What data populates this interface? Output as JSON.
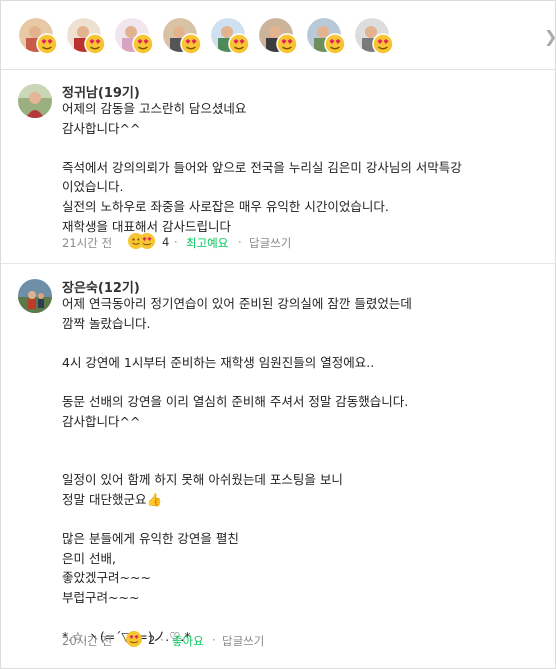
{
  "reactors": {
    "count": 9,
    "next_icon": "chevron-right-icon",
    "reaction_icon": "heart-eyes-emoji-icon"
  },
  "comments": [
    {
      "author": "정귀남(19기)",
      "lines": [
        "어제의 감동을 고스란히 담으셨네요",
        "감사합니다^^",
        "",
        "즉석에서 강의의뢰가 들어와 앞으로 전국을 누리실 김은미 강사님의 서막특강",
        "이었습니다.",
        "실전의 노하우로 좌중을 사로잡은 매우 유익한 시간이었습니다.",
        "재학생을 대표해서 감사드립니다"
      ],
      "time": "21시간 전",
      "reaction_count": "4",
      "reaction_label": "최고예요",
      "reply_label": "답글쓰기"
    },
    {
      "author": "장은숙(12기)",
      "lines": [
        "어제 연극동아리 정기연습이 있어 준비된 강의실에 잠깐 들렸었는데",
        "깜짝 놀랐습니다.",
        "",
        "4시 강연에 1시부터 준비하는 재학생 임원진들의 열정에요..",
        "",
        "동문 선배의 강연을 이리 열심히 준비해 주셔서 정말 감동했습니다.",
        "감사합니다^^",
        "",
        "",
        "일정이 있어 함께 하지 못해 아쉬웠는데 포스팅을 보니",
        "정말 대단했군요👍",
        "",
        "많은 분들에게 유익한 강연을 펼친",
        "은미 선배,",
        "좋았겠구려~~~",
        "부럽구려~~~",
        "",
        "*.☆.ヽ(=´▽`=)ノ.♡.*"
      ],
      "time": "20시간 전",
      "reaction_count": "2",
      "reaction_label": "좋아요",
      "reply_label": "답글쓰기"
    }
  ],
  "colors": {
    "accent_green": "#03c75a",
    "meta_gray": "#8b8b8b",
    "emoji_yellow": "#f7c531"
  }
}
